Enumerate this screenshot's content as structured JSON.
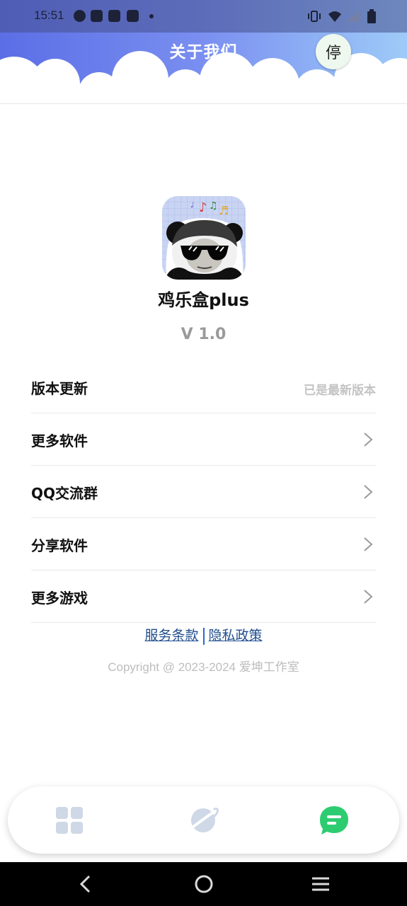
{
  "status_bar": {
    "time": "15:51"
  },
  "header": {
    "title": "关于我们",
    "stop_button_label": "停"
  },
  "app": {
    "name": "鸡乐盒plus",
    "version": "V 1.0"
  },
  "menu": [
    {
      "label": "版本更新",
      "value": "已是最新版本",
      "icon": ""
    },
    {
      "label": "更多软件",
      "value": "",
      "icon": "chevron-right-icon"
    },
    {
      "label": "QQ交流群",
      "value": "",
      "icon": "chevron-right-icon"
    },
    {
      "label": "分享软件",
      "value": "",
      "icon": "chevron-right-icon"
    },
    {
      "label": "更多游戏",
      "value": "",
      "icon": "chevron-right-icon"
    }
  ],
  "footer": {
    "terms_link": "服务条款",
    "privacy_link": "隐私政策",
    "copyright": "Copyright @ 2023-2024 爱坤工作室"
  },
  "tabbar": {
    "tabs": [
      {
        "icon": "grid-icon",
        "active": false
      },
      {
        "icon": "planet-icon",
        "active": false
      },
      {
        "icon": "chat-icon",
        "active": true
      }
    ],
    "active_color": "#2ecc71",
    "inactive_color": "#cfd8e6"
  },
  "colors": {
    "header_gradient_start": "#5b6ee6",
    "header_gradient_end": "#9ecbf8",
    "link_color": "#1f4d8c"
  }
}
